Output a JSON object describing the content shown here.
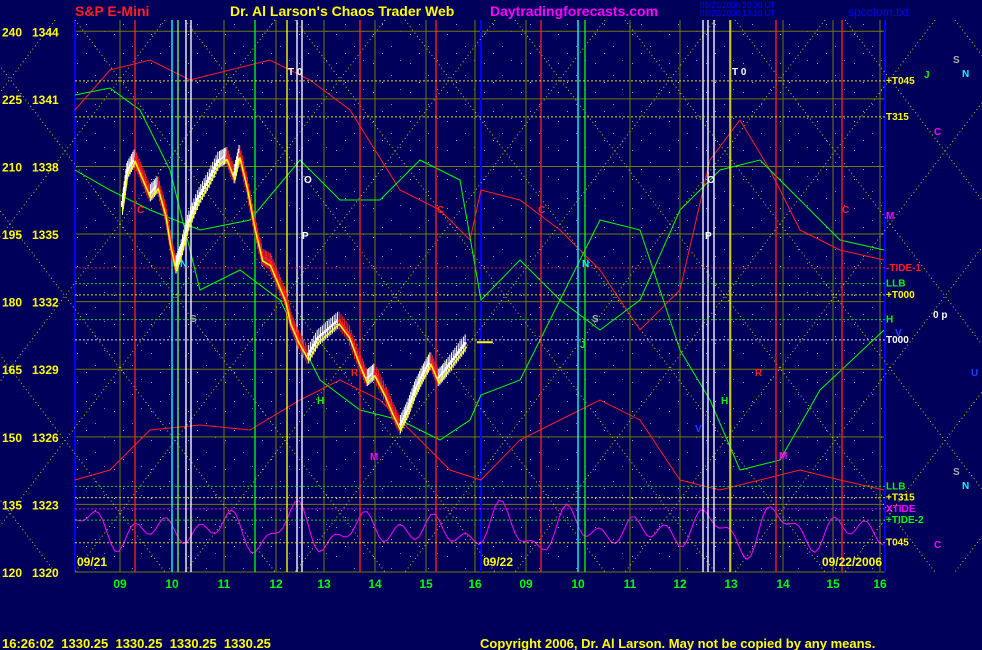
{
  "header": {
    "symbol": "S&P E-Mini",
    "title": "Dr. Al Larson's Chaos Trader Web",
    "site": "Daytradingforecasts.com",
    "stamp_line1": "09/21/2006 20:30 UT",
    "stamp_line2": "09/22/2006 13:10 UT",
    "file": "spcctom.txt"
  },
  "footer": {
    "quote": "16:26:02  1330.25  1330.25  1330.25  1330.25",
    "copyright": "Copyright 2006, Dr. Al Larson. May not be copied by any means."
  },
  "colors": {
    "background": "#00005a",
    "grid": "#6f7a00",
    "yellow": "#ffff00",
    "green": "#00ff00",
    "red": "#ff2020",
    "magenta": "#ff00ff",
    "cyan": "#00ffff",
    "white": "#ffffff"
  },
  "chart_data": {
    "type": "candlestick",
    "title": "S&P E-Mini",
    "left_axis_labels": [
      "240",
      "225",
      "210",
      "195",
      "180",
      "165",
      "150",
      "135",
      "120"
    ],
    "price_labels": [
      "1344",
      "1341",
      "1338",
      "1335",
      "1332",
      "1329",
      "1326",
      "1323",
      "1320"
    ],
    "ylim": [
      1320,
      1344.5
    ],
    "dates": [
      "09/21",
      "09/22",
      "09/22/2006"
    ],
    "x_ticks": [
      "09",
      "10",
      "11",
      "12",
      "13",
      "14",
      "15",
      "16",
      "09",
      "10",
      "11",
      "12",
      "13",
      "14",
      "15",
      "16"
    ],
    "price_path": [
      [
        9.05,
        1336.2
      ],
      [
        9.15,
        1337.8
      ],
      [
        9.3,
        1338.4
      ],
      [
        9.45,
        1337.6
      ],
      [
        9.6,
        1336.8
      ],
      [
        9.75,
        1337.2
      ],
      [
        9.9,
        1336.0
      ],
      [
        10.0,
        1334.6
      ],
      [
        10.1,
        1333.6
      ],
      [
        10.2,
        1334.2
      ],
      [
        10.35,
        1335.5
      ],
      [
        10.55,
        1336.6
      ],
      [
        10.75,
        1337.4
      ],
      [
        10.95,
        1338.3
      ],
      [
        11.1,
        1338.5
      ],
      [
        11.25,
        1337.6
      ],
      [
        11.35,
        1338.6
      ],
      [
        11.5,
        1337.2
      ],
      [
        11.65,
        1335.4
      ],
      [
        11.8,
        1334.0
      ],
      [
        11.95,
        1333.8
      ],
      [
        12.1,
        1333.0
      ],
      [
        12.25,
        1332.2
      ],
      [
        12.35,
        1331.2
      ],
      [
        12.5,
        1330.4
      ],
      [
        12.7,
        1329.6
      ],
      [
        12.9,
        1330.4
      ],
      [
        13.1,
        1330.8
      ],
      [
        13.3,
        1331.2
      ],
      [
        13.5,
        1330.6
      ],
      [
        13.7,
        1329.4
      ],
      [
        13.85,
        1328.6
      ],
      [
        14.0,
        1328.9
      ],
      [
        14.2,
        1328.0
      ],
      [
        14.35,
        1327.2
      ],
      [
        14.5,
        1326.5
      ],
      [
        14.65,
        1327.2
      ],
      [
        14.8,
        1328.1
      ],
      [
        14.95,
        1328.8
      ],
      [
        15.1,
        1329.4
      ],
      [
        15.25,
        1328.6
      ],
      [
        15.4,
        1329.0
      ],
      [
        15.6,
        1329.6
      ],
      [
        15.8,
        1330.2
      ]
    ],
    "levels": [
      {
        "name": "+T045",
        "price": 1341.8
      },
      {
        "name": "T315",
        "price": 1340.2
      },
      {
        "name": "-TIDE-1",
        "price": 1333.5
      },
      {
        "name": "LLB",
        "price": 1332.8
      },
      {
        "name": "+T000",
        "price": 1332.3
      },
      {
        "name": "H",
        "price": 1331.2
      },
      {
        "name": "T000",
        "price": 1330.3
      },
      {
        "name": "LLB",
        "price": 1323.8
      },
      {
        "name": "+T315",
        "price": 1323.3
      },
      {
        "name": "XTIDE",
        "price": 1322.8
      },
      {
        "name": "+TIDE-2",
        "price": 1322.3
      },
      {
        "name": "T045",
        "price": 1321.3
      }
    ],
    "planet_markers": [
      "T 0",
      "T 0",
      "C",
      "C",
      "C",
      "C",
      "N",
      "N",
      "S",
      "S",
      "S",
      "S",
      "O",
      "O",
      "P",
      "P",
      "R",
      "R",
      "H",
      "H",
      "M",
      "M",
      "M",
      "J",
      "J",
      "V",
      "V",
      "U",
      "0 p",
      "C",
      "C"
    ]
  }
}
